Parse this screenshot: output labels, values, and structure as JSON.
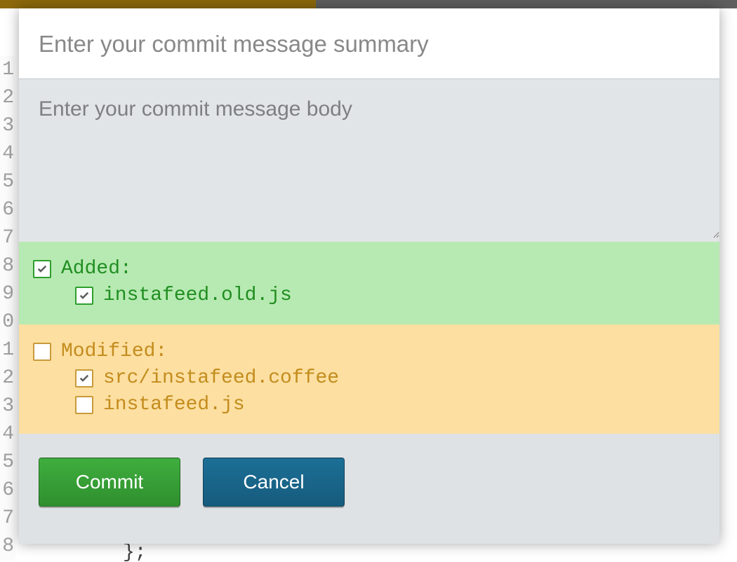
{
  "summary_placeholder": "Enter your commit message summary",
  "body_placeholder": "Enter your commit message body",
  "sections": {
    "added": {
      "label": "Added:",
      "checked": true,
      "files": [
        {
          "name": "instafeed.old.js",
          "checked": true
        }
      ]
    },
    "modified": {
      "label": "Modified:",
      "checked": false,
      "files": [
        {
          "name": "src/instafeed.coffee",
          "checked": true
        },
        {
          "name": "instafeed.js",
          "checked": false
        }
      ]
    }
  },
  "buttons": {
    "commit": "Commit",
    "cancel": "Cancel"
  },
  "background": {
    "gutter_lines": [
      "1",
      "2",
      "3",
      "4",
      "5",
      "6",
      "7",
      "8",
      "9",
      "0",
      "1",
      "2",
      "3",
      "4",
      "5",
      "6",
      "7",
      "8"
    ],
    "code_snippet": "};"
  }
}
